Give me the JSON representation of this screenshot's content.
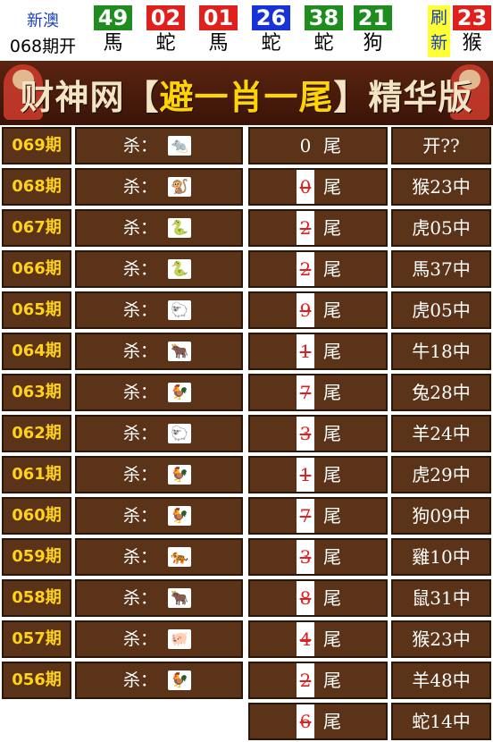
{
  "header": {
    "region": "新澳",
    "period": "068期开",
    "balls": [
      {
        "num": "49",
        "zodiac": "馬",
        "color": "#1e8c1e"
      },
      {
        "num": "02",
        "zodiac": "蛇",
        "color": "#e0201c"
      },
      {
        "num": "01",
        "zodiac": "馬",
        "color": "#e0201c"
      },
      {
        "num": "26",
        "zodiac": "蛇",
        "color": "#1632d8"
      },
      {
        "num": "38",
        "zodiac": "蛇",
        "color": "#1e8c1e"
      },
      {
        "num": "21",
        "zodiac": "狗",
        "color": "#1e8c1e"
      }
    ],
    "refresh_label": "刷新",
    "special": {
      "num": "23",
      "zodiac": "猴",
      "color": "#e0201c"
    }
  },
  "banner": {
    "prefix": "财神网【",
    "highlight": "避一肖一尾",
    "suffix": "】精华版"
  },
  "kill_label": "杀：",
  "left_rows": [
    {
      "period": "069期",
      "icon": "🐀"
    },
    {
      "period": "068期",
      "icon": "🐒"
    },
    {
      "period": "067期",
      "icon": "🐍"
    },
    {
      "period": "066期",
      "icon": "🐍"
    },
    {
      "period": "065期",
      "icon": "🐑"
    },
    {
      "period": "064期",
      "icon": "🐂"
    },
    {
      "period": "063期",
      "icon": "🐓"
    },
    {
      "period": "062期",
      "icon": "🐑"
    },
    {
      "period": "061期",
      "icon": "🐓"
    },
    {
      "period": "060期",
      "icon": "🐓"
    },
    {
      "period": "059期",
      "icon": "🐅"
    },
    {
      "period": "058期",
      "icon": "🐂"
    },
    {
      "period": "057期",
      "icon": "🐖"
    },
    {
      "period": "056期",
      "icon": "🐓"
    }
  ],
  "tail_word": "尾",
  "right_rows": [
    {
      "digit": "0",
      "crossed": false,
      "result": "开??"
    },
    {
      "digit": "0",
      "crossed": true,
      "result": "猴23中"
    },
    {
      "digit": "2",
      "crossed": true,
      "result": "虎05中"
    },
    {
      "digit": "2",
      "crossed": true,
      "result": "馬37中"
    },
    {
      "digit": "9",
      "crossed": true,
      "result": "虎05中"
    },
    {
      "digit": "1",
      "crossed": true,
      "result": "牛18中"
    },
    {
      "digit": "7",
      "crossed": true,
      "result": "兔28中"
    },
    {
      "digit": "3",
      "crossed": true,
      "result": "羊24中"
    },
    {
      "digit": "1",
      "crossed": true,
      "result": "虎29中"
    },
    {
      "digit": "7",
      "crossed": true,
      "result": "狗09中"
    },
    {
      "digit": "3",
      "crossed": true,
      "result": "雞10中"
    },
    {
      "digit": "8",
      "crossed": true,
      "result": "鼠31中"
    },
    {
      "digit": "4",
      "crossed": true,
      "result": "猴23中"
    },
    {
      "digit": "2",
      "crossed": true,
      "result": "羊48中"
    },
    {
      "digit": "6",
      "crossed": true,
      "result": "蛇14中"
    }
  ]
}
